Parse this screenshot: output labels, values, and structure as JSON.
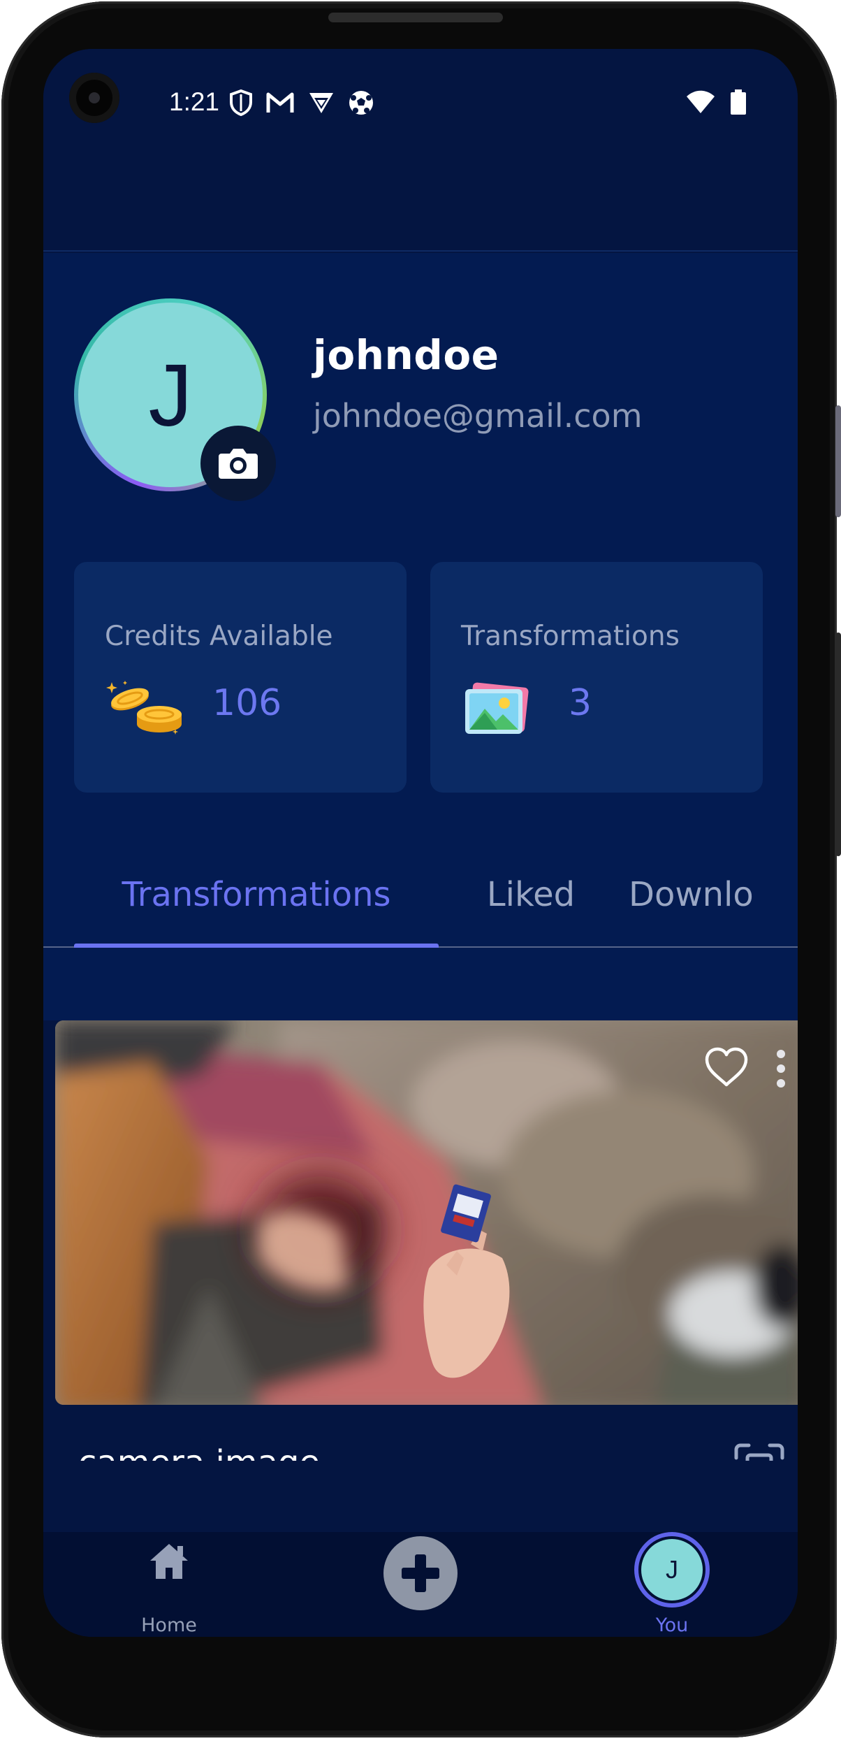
{
  "status_bar": {
    "time": "1:21",
    "left_icons": [
      "shield-icon",
      "gmail-icon",
      "app-icon",
      "soccer-ball-icon"
    ],
    "right_icons": [
      "wifi-icon",
      "battery-icon"
    ]
  },
  "profile": {
    "avatar_initial": "J",
    "username": "johndoe",
    "email": "johndoe@gmail.com",
    "avatar_color": "#86d9d9"
  },
  "stats": [
    {
      "label": "Credits Available",
      "value": "106",
      "icon": "coins-icon"
    },
    {
      "label": "Transformations",
      "value": "3",
      "icon": "images-icon"
    }
  ],
  "tabs": [
    {
      "label": "Transformations",
      "active": true
    },
    {
      "label": "Liked",
      "active": false
    },
    {
      "label": "Downlo",
      "active": false
    }
  ],
  "feed": {
    "items": [
      {
        "caption": "camera image",
        "liked": false
      }
    ]
  },
  "bottom_nav": {
    "home_label": "Home",
    "you_label": "You",
    "you_initial": "J"
  },
  "colors": {
    "background": "#041541",
    "card": "#0b2a64",
    "accent": "#6b73f1",
    "muted_text": "#9aa7c4"
  }
}
